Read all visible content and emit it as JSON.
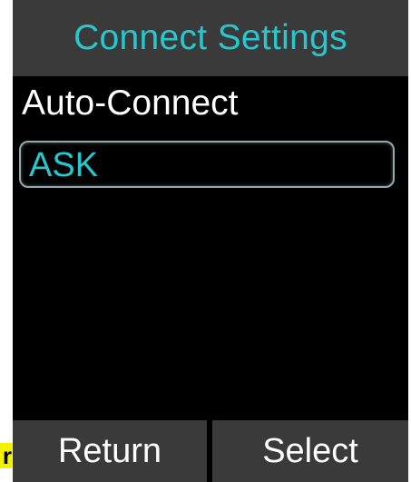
{
  "header": {
    "title": "Connect Settings"
  },
  "menu": {
    "label": "Auto-Connect",
    "selected_option": "ASK"
  },
  "softkeys": {
    "left_label": "Return",
    "right_label": "Select"
  },
  "edge_mark": {
    "text": "r"
  },
  "colors": {
    "accent": "#27c7cf",
    "bar_background": "#3a3a3a",
    "screen_background": "#000000",
    "text": "#ffffff",
    "highlight": "#f2f200"
  }
}
